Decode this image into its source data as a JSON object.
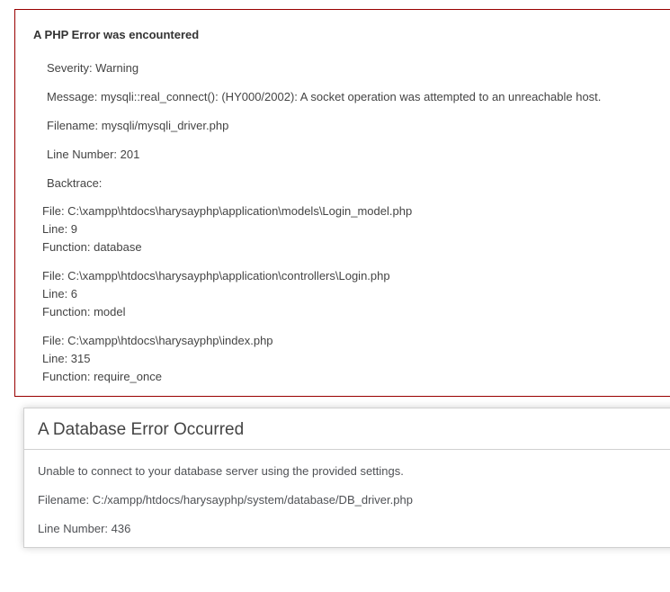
{
  "php_error": {
    "title": "A PHP Error was encountered",
    "severity": "Severity: Warning",
    "message": "Message: mysqli::real_connect(): (HY000/2002): A socket operation was attempted to an unreachable host.",
    "filename": "Filename: mysqli/mysqli_driver.php",
    "line_number": "Line Number: 201",
    "backtrace_label": "Backtrace:",
    "backtrace": [
      {
        "file": "File: C:\\xampp\\htdocs\\harysayphp\\application\\models\\Login_model.php",
        "line": "Line: 9",
        "function": "Function: database"
      },
      {
        "file": "File: C:\\xampp\\htdocs\\harysayphp\\application\\controllers\\Login.php",
        "line": "Line: 6",
        "function": "Function: model"
      },
      {
        "file": "File: C:\\xampp\\htdocs\\harysayphp\\index.php",
        "line": "Line: 315",
        "function": "Function: require_once"
      }
    ]
  },
  "db_error": {
    "title": "A Database Error Occurred",
    "message": "Unable to connect to your database server using the provided settings.",
    "filename": "Filename: C:/xampp/htdocs/harysayphp/system/database/DB_driver.php",
    "line_number": "Line Number: 436"
  }
}
